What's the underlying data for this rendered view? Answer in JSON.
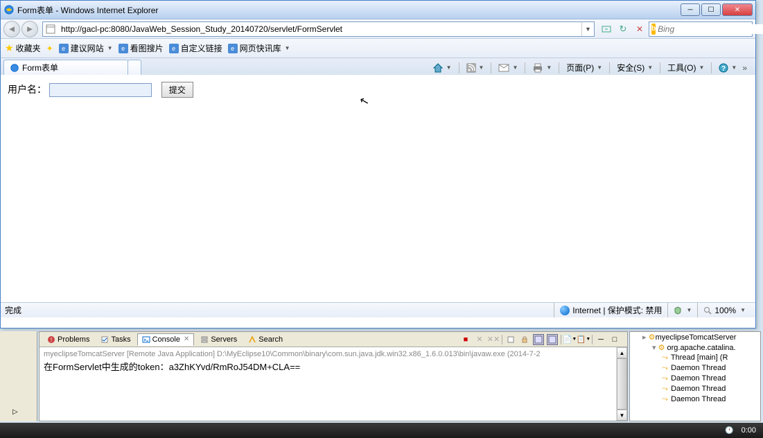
{
  "window": {
    "title": "Form表单 - Windows Internet Explorer"
  },
  "nav": {
    "url": "http://gacl-pc:8080/JavaWeb_Session_Study_20140720/servlet/FormServlet",
    "search_placeholder": "Bing"
  },
  "favorites": {
    "label": "收藏夹",
    "items": [
      "建议网站",
      "看图搜片",
      "自定义链接",
      "网页快讯库"
    ]
  },
  "tab": {
    "title": "Form表单"
  },
  "commands": {
    "page": "页面(P)",
    "safety": "安全(S)",
    "tools": "工具(O)"
  },
  "form": {
    "username_label": "用户名：",
    "submit_label": "提交"
  },
  "status": {
    "done": "完成",
    "zone": "Internet | 保护模式: 禁用",
    "zoom": "100%"
  },
  "ide": {
    "tabs": [
      "Problems",
      "Tasks",
      "Console",
      "Servers",
      "Search"
    ],
    "header": "myeclipseTomcatServer [Remote Java Application] D:\\MyEclipse10\\Common\\binary\\com.sun.java.jdk.win32.x86_1.6.0.013\\bin\\javaw.exe (2014-7-2",
    "output": "在FormServlet中生成的token：a3ZhKYvd/RmRoJ54DM+CLA=="
  },
  "debug": {
    "root": "myeclipseTomcatServer",
    "process": "org.apache.catalina.",
    "threads": [
      "Thread [main] (R",
      "Daemon Thread",
      "Daemon Thread",
      "Daemon Thread",
      "Daemon Thread"
    ]
  },
  "taskbar": {
    "time": "0:00"
  }
}
